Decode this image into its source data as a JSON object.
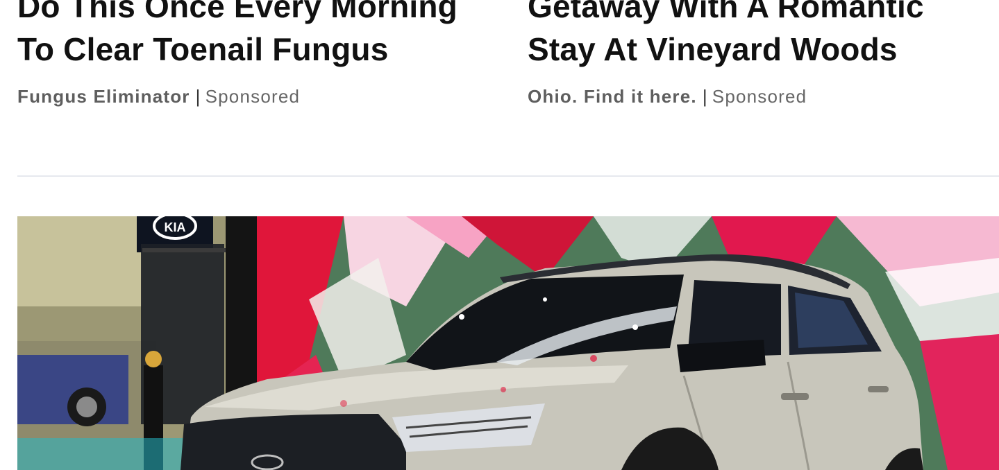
{
  "ads": [
    {
      "headline_line1": "Do This Once Every Morning",
      "headline_line2": "To Clear Toenail Fungus",
      "source": "Fungus Eliminator",
      "separator": "|",
      "label": "Sponsored"
    },
    {
      "headline_line1": "Getaway With A Romantic",
      "headline_line2": "Stay At Vineyard Woods",
      "source": "Ohio. Find it here.",
      "separator": "|",
      "label": "Sponsored"
    }
  ],
  "hero_image": {
    "logo_text": "KIA",
    "colors": {
      "background_left": "#b4b08a",
      "backdrop_red": "#e0163a",
      "backdrop_pink": "#f7a3c4",
      "backdrop_green": "#4f7a5a",
      "car_body": "#c8c6bb",
      "glass": "#111418"
    }
  }
}
